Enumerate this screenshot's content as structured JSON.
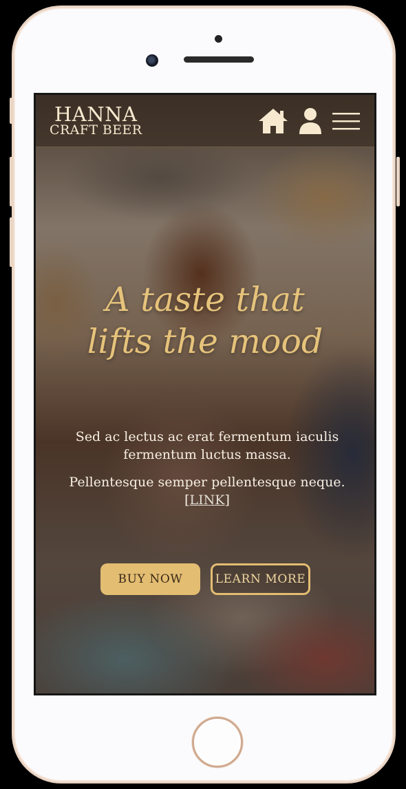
{
  "brand": {
    "line1": "HANNA",
    "line2": "CRAFT BEER"
  },
  "nav": {
    "icons": [
      "home-icon",
      "user-icon",
      "hamburger-menu-icon"
    ]
  },
  "hero": {
    "heading_line1": "A taste that",
    "heading_line2": "lifts the mood",
    "paragraph1": "Sed ac lectus ac erat fermentum iaculis fermentum luctus massa.",
    "paragraph2_text": "Pellentesque semper pellentesque neque. [",
    "paragraph2_link": "LINK",
    "paragraph2_end": "]"
  },
  "buttons": {
    "buy": "BUY NOW",
    "learn": "LEARN MORE"
  },
  "colors": {
    "accent": "#e3bd72",
    "logo": "#f6e9cf",
    "body_text": "#f7efe4",
    "phone_frame": "#e9d3c2"
  }
}
